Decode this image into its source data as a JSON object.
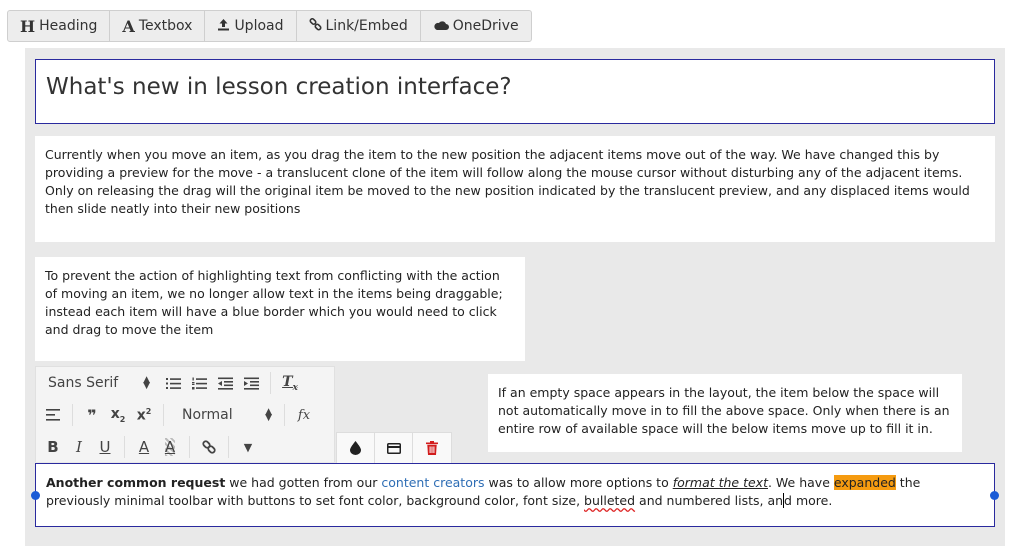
{
  "top_toolbar": {
    "buttons": [
      {
        "icon": "H",
        "label": "Heading"
      },
      {
        "icon": "A",
        "label": "Textbox"
      },
      {
        "icon": "upload-icon",
        "label": "Upload"
      },
      {
        "icon": "link-icon",
        "label": "Link/Embed"
      },
      {
        "icon": "cloud-icon",
        "label": "OneDrive"
      }
    ]
  },
  "lesson": {
    "title": "What's new in lesson creation interface?",
    "p1": "Currently when you move an item, as you drag the item to the new position the adjacent items move out of the way. We have changed this by providing a preview for the move - a translucent clone of the item will follow along the mouse cursor without disturbing any of the adjacent items. Only on releasing the drag will the original item be moved to the new position indicated by the translucent preview, and any displaced items would then slide neatly into their new positions",
    "p2": "To prevent the action of highlighting text from conflicting with the action of moving an item, we no longer allow text in the items being draggable; instead each item will have a blue border which you would need to click and drag to move the item",
    "p3": "If an empty space appears in the layout, the item below the space will not automatically move in to fill the above space. Only when there is an entire row of available space will the below items move up to fill it in.",
    "p4": {
      "bold": "Another common request",
      "t1": " we had gotten from our ",
      "link": "content creators",
      "t2": " was to allow more options to ",
      "italic": "format the text",
      "t3": ". We have ",
      "highlight": "expanded",
      "t4": " the previously minimal toolbar with buttons to set font color, background color, font size, ",
      "spell": "bulleted",
      "t5": " and numbered lists, an",
      "t6": "d more."
    }
  },
  "editor_toolbar": {
    "font_family": "Sans Serif",
    "heading": "Normal",
    "formula": "fx"
  },
  "colors": {
    "selection_border": "#2a2a9e",
    "highlight": "#f59b10",
    "link": "#2f6eb5",
    "delete": "#d21c1c"
  }
}
